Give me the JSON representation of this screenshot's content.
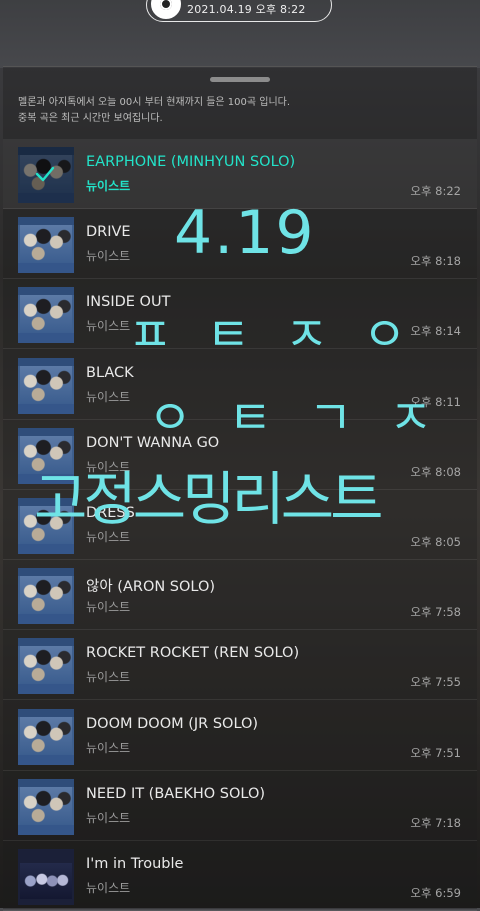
{
  "status": {
    "datetime": "2021.04.19 오후 8:22"
  },
  "info": {
    "line1": "멜론과 아지톡에서 오늘 00시 부터 현재까지 들은 100곡 입니다.",
    "line2": "중복 곡은 최근 시간만 보여집니다."
  },
  "tracks": [
    {
      "title": "EARPHONE (MINHYUN SOLO)",
      "artist": "뉴이스트",
      "time": "오후 8:22",
      "active": true
    },
    {
      "title": "DRIVE",
      "artist": "뉴이스트",
      "time": "오후 8:18"
    },
    {
      "title": "INSIDE OUT",
      "artist": "뉴이스트",
      "time": "오후 8:14"
    },
    {
      "title": "BLACK",
      "artist": "뉴이스트",
      "time": "오후 8:11"
    },
    {
      "title": "DON'T WANNA GO",
      "artist": "뉴이스트",
      "time": "오후 8:08"
    },
    {
      "title": "DRESS",
      "artist": "뉴이스트",
      "time": "오후 8:05"
    },
    {
      "title": "않아 (ARON SOLO)",
      "artist": "뉴이스트",
      "time": "오후 7:58"
    },
    {
      "title": "ROCKET ROCKET (REN SOLO)",
      "artist": "뉴이스트",
      "time": "오후 7:55"
    },
    {
      "title": "DOOM DOOM (JR SOLO)",
      "artist": "뉴이스트",
      "time": "오후 7:51"
    },
    {
      "title": "NEED IT (BAEKHO SOLO)",
      "artist": "뉴이스트",
      "time": "오후 7:18"
    },
    {
      "title": "I'm in Trouble",
      "artist": "뉴이스트",
      "time": "오후 6:59"
    }
  ],
  "overlay": {
    "line1": "4.19",
    "line2": "ㅍㅌㅈㅇ",
    "line3": "ㅇㅌㄱㅈ",
    "line4": "고정스밍리스트"
  },
  "colors": {
    "accent": "#23e3c9",
    "overlay_text": "#6fe3e6"
  },
  "icons": {
    "playing": "check-icon",
    "app_logo": "melon-disc-icon"
  }
}
